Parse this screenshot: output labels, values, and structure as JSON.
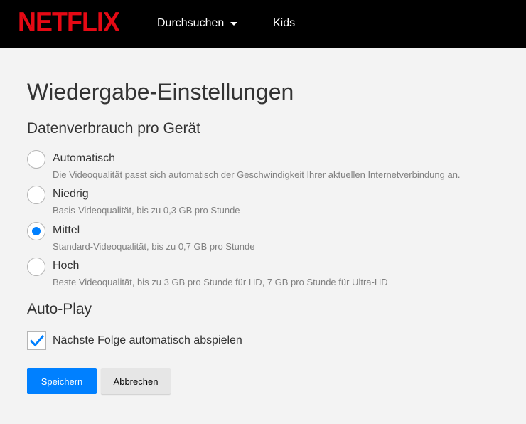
{
  "header": {
    "logo": "NETFLIX",
    "nav": {
      "browse_label": "Durchsuchen",
      "kids_label": "Kids"
    }
  },
  "page": {
    "title": "Wiedergabe-Einstellungen",
    "data_usage": {
      "heading": "Datenverbrauch pro Gerät",
      "selected": "Mittel",
      "options": [
        {
          "label": "Automatisch",
          "description": "Die Videoqualität passt sich automatisch der Geschwindigkeit Ihrer aktuellen Internetverbindung an.",
          "checked": false
        },
        {
          "label": "Niedrig",
          "description": "Basis-Videoqualität, bis zu 0,3 GB pro Stunde",
          "checked": false
        },
        {
          "label": "Mittel",
          "description": "Standard-Videoqualität, bis zu 0,7 GB pro Stunde",
          "checked": true
        },
        {
          "label": "Hoch",
          "description": "Beste Videoqualität, bis zu 3 GB pro Stunde für HD, 7 GB pro Stunde für Ultra-HD",
          "checked": false
        }
      ]
    },
    "autoplay": {
      "heading": "Auto-Play",
      "next_episode_label": "Nächste Folge automatisch abspielen",
      "next_episode_checked": true
    },
    "buttons": {
      "save_label": "Speichern",
      "cancel_label": "Abbrechen"
    }
  },
  "colors": {
    "brand": "#e50914",
    "accent": "#0080ff",
    "header_bg": "#000000",
    "page_bg": "#f3f3f3"
  }
}
